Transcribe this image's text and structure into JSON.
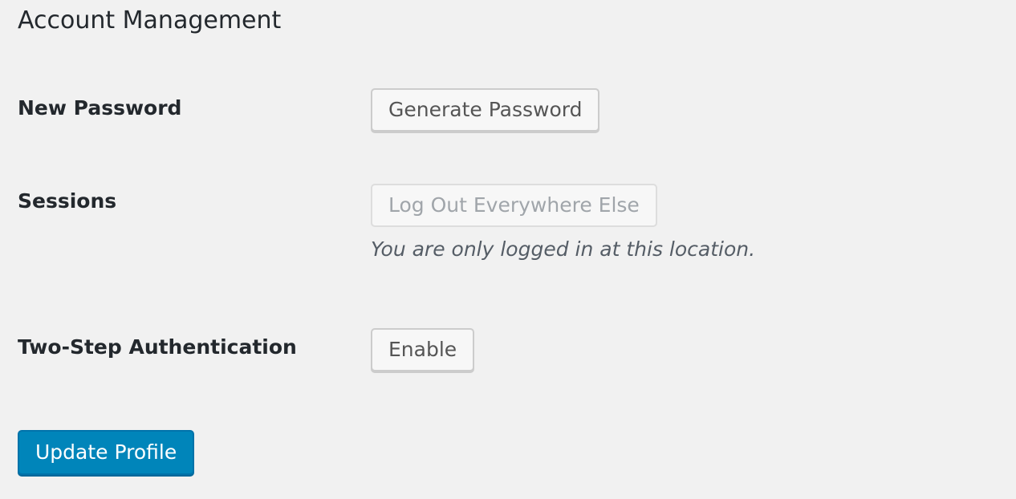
{
  "section": {
    "title": "Account Management"
  },
  "new_password": {
    "label": "New Password",
    "button_label": "Generate Password"
  },
  "sessions": {
    "label": "Sessions",
    "button_label": "Log Out Everywhere Else",
    "button_disabled": true,
    "note": "You are only logged in at this location."
  },
  "two_step": {
    "label": "Two-Step Authentication",
    "button_label": "Enable"
  },
  "submit": {
    "label": "Update Profile"
  },
  "colors": {
    "background": "#f1f1f1",
    "primary": "#0085ba",
    "text": "#23282d"
  }
}
